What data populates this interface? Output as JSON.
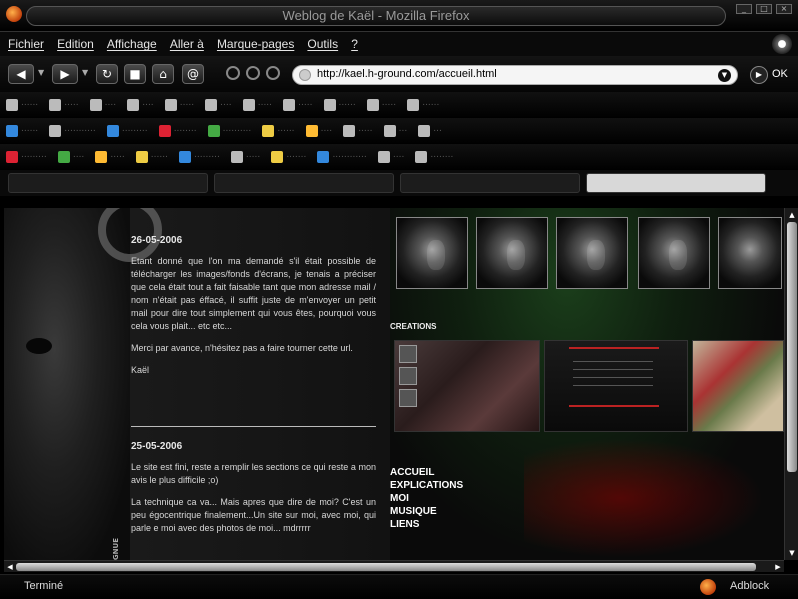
{
  "window": {
    "title": "Weblog de Kaël - Mozilla Firefox"
  },
  "menubar": {
    "items": [
      "Fichier",
      "Edition",
      "Affichage",
      "Aller à",
      "Marque-pages",
      "Outils",
      "?"
    ]
  },
  "navbar": {
    "url": "http://kael.h-ground.com/accueil.html",
    "go_label": "OK",
    "icons": [
      "back-icon",
      "forward-icon",
      "reload-icon",
      "stop-icon",
      "home-icon",
      "print-icon",
      "at-icon",
      "zoom-icon",
      "zoom-out-icon",
      "zoom-in-icon"
    ]
  },
  "page": {
    "posts": [
      {
        "date": "26-05-2006",
        "paragraphs": [
          "Etant donné que l'on ma demandé s'il était possible de télécharger les images/fonds d'écrans, je tenais a préciser que cela était tout a fait faisable tant que mon adresse mail / nom n'était pas éffacé, il suffit juste de m'envoyer un petit mail pour dire tout simplement qui vous êtes, pourquoi vous cela vous plait... etc etc...",
          "Merci par avance, n'hésitez pas a faire tourner cette url."
        ],
        "signature": "Kaël"
      },
      {
        "date": "25-05-2006",
        "paragraphs": [
          "Le site est fini, reste a remplir les sections ce qui reste a mon avis le plus difficile ;o)",
          "La technique ca va... Mais apres que dire de moi? C'est un peu égocentrique finalement...Un site sur moi, avec moi, qui parle e moi avec des photos de moi... mdrrrrr"
        ]
      }
    ],
    "creations_title": "CREATIONS",
    "nav": [
      "ACCUEIL",
      "EXPLICATIONS",
      "MOI",
      "MUSIQUE",
      "LIENS"
    ],
    "vertical_text": "GNUE"
  },
  "statusbar": {
    "text": "Terminé",
    "addon": "Adblock"
  }
}
